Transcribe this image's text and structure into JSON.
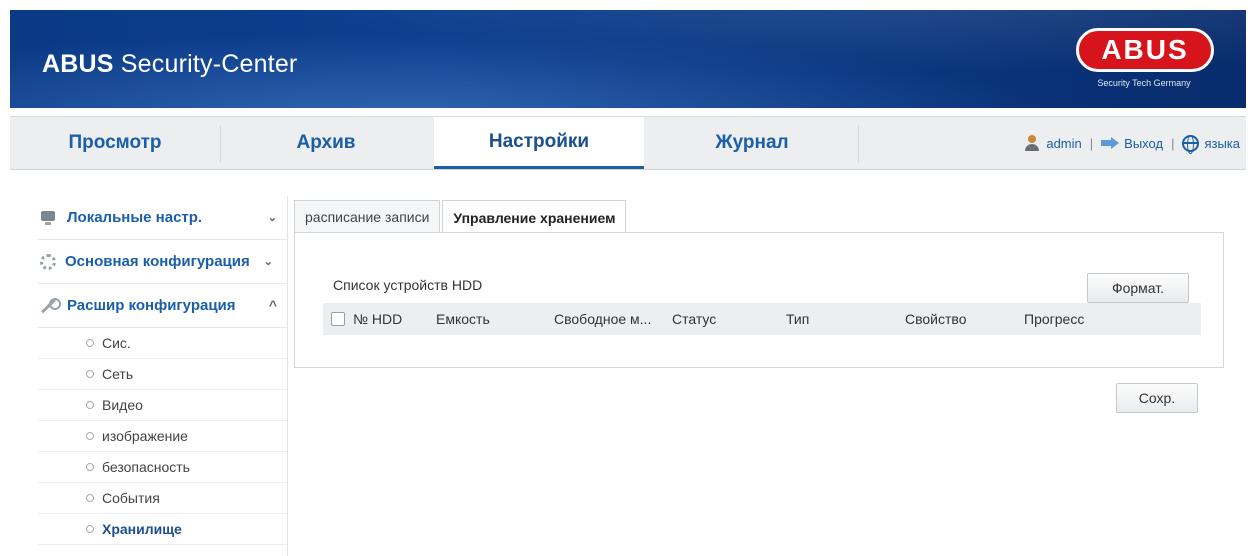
{
  "header": {
    "title_bold": "ABUS",
    "title_rest": " Security-Center",
    "logo_text": "ABUS",
    "logo_tagline": "Security Tech Germany"
  },
  "nav": {
    "tabs": [
      {
        "label": "Просмотр",
        "active": false
      },
      {
        "label": "Архив",
        "active": false
      },
      {
        "label": "Настройки",
        "active": true
      },
      {
        "label": "Журнал",
        "active": false
      }
    ],
    "user": "admin",
    "sep": "|",
    "logout": "Выход",
    "language": "языка"
  },
  "sidebar": {
    "sections": [
      {
        "label": "Локальные настр.",
        "icon": "monitor-icon",
        "chevron": "⌄"
      },
      {
        "label": "Основная конфигурация",
        "icon": "gear-icon",
        "chevron": "⌄"
      },
      {
        "label": "Расшир конфигурация",
        "icon": "wrench-icon",
        "chevron": "^"
      }
    ],
    "items": [
      {
        "label": "Сис."
      },
      {
        "label": "Сеть"
      },
      {
        "label": "Видео"
      },
      {
        "label": "изображение"
      },
      {
        "label": "безопасность"
      },
      {
        "label": "События"
      },
      {
        "label": "Хранилище",
        "active": true
      }
    ]
  },
  "content": {
    "tabs": [
      {
        "label": "расписание записи",
        "active": false
      },
      {
        "label": "Управление хранением",
        "active": true
      }
    ],
    "hdd_list_title": "Список устройств HDD",
    "format_button": "Формат.",
    "columns": [
      "№ HDD",
      "Емкость",
      "Свободное м...",
      "Статус",
      "Тип",
      "Свойство",
      "Прогресс"
    ],
    "save_button": "Сохр."
  },
  "colors": {
    "accent": "#1a5fa8",
    "banner": "#0a3a86",
    "logo_red": "#d7141b"
  }
}
